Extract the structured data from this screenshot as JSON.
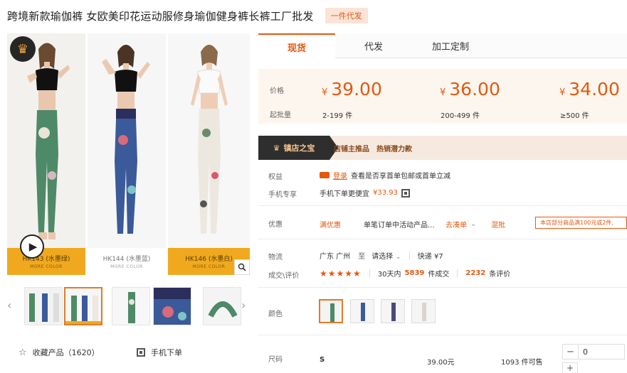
{
  "product": {
    "title": "跨境新款瑜伽裤 女欧美印花运动服修身瑜伽健身裤长裤工厂批发",
    "tag": "一件代发"
  },
  "gallery": {
    "captions": [
      {
        "name": "HK143 (水墨绿)",
        "sub": "MORE COLOR"
      },
      {
        "name": "HK144 (水墨蓝)",
        "sub": "MORE COLOR"
      },
      {
        "name": "HK146 (水墨白)",
        "sub": "MORE COLOR"
      }
    ]
  },
  "actions": {
    "favorite": "收藏产品（1620）",
    "mobile_order": "手机下单"
  },
  "tabs": [
    "现货",
    "代发",
    "加工定制"
  ],
  "pricing": {
    "price_label": "价格",
    "moq_label": "起批量",
    "currency": "¥",
    "tiers": [
      {
        "price": "39.00",
        "qty": "2-199 件"
      },
      {
        "price": "36.00",
        "qty": "200-499 件"
      },
      {
        "price": "34.00",
        "qty": "≥500 件"
      }
    ]
  },
  "banner": {
    "badge": "镇店之宝",
    "text1": "店铺主推品",
    "text2": "热销潜力款"
  },
  "rights": {
    "label": "权益",
    "login": "登录",
    "text": "查看是否享首单包邮或首单立减"
  },
  "mobile_exclusive": {
    "label": "手机专享",
    "text": "手机下单更便宜",
    "price": "¥33.93"
  },
  "discount": {
    "label": "优惠",
    "coupon": "满优惠",
    "desc": "单笔订单中活动产品...",
    "link": "去凑单",
    "mixed": "混批",
    "promo": "本店部分商品满100元或2件,"
  },
  "logistics": {
    "label": "物流",
    "from": "广东 广州",
    "to_word": "至",
    "to_select": "请选择",
    "express": "快递 ¥7"
  },
  "deals": {
    "label": "成交\\评价",
    "stars": "★★★★★",
    "sales_prefix": "30天内",
    "sales_num": "5839",
    "sales_suffix": "件成交",
    "review_num": "2232",
    "review_suffix": "条评价"
  },
  "color": {
    "label": "颜色"
  },
  "size": {
    "label": "尺码",
    "value": "S",
    "price": "39.00元",
    "stock": "1093 件可售",
    "qty": "0"
  }
}
